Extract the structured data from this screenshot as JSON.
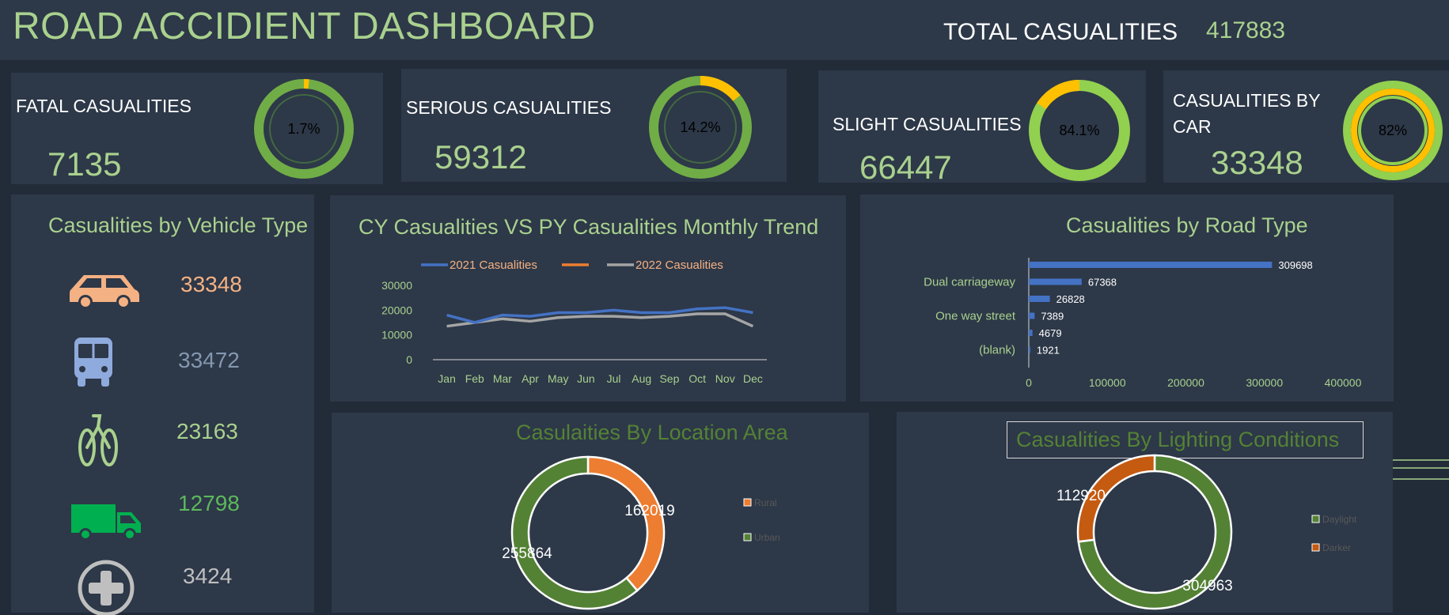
{
  "header": {
    "title": "ROAD ACCIDIENT DASHBOARD",
    "total_label": "TOTAL CASUALITIES",
    "total_value": "417883"
  },
  "kpis": [
    {
      "label": "FATAL CASUALITIES",
      "value": "7135",
      "pct_label": "1.7%",
      "pct": 1.7
    },
    {
      "label": "SERIOUS CASUALITIES",
      "value": "59312",
      "pct_label": "14.2%",
      "pct": 14.2
    },
    {
      "label": "SLIGHT CASUALITIES",
      "value": "66447",
      "pct_label": "84.1%",
      "pct": 84.1
    },
    {
      "label_line1": "CASUALITIES BY",
      "label_line2": "CAR",
      "value": "33348",
      "pct_label": "82%",
      "pct": 82
    }
  ],
  "vehicle": {
    "title": "Casualities by Vehicle Type",
    "items": [
      {
        "icon": "car-icon",
        "value": "33348",
        "color": "#f4b183"
      },
      {
        "icon": "bus-icon",
        "value": "33472",
        "color": "#8497b0"
      },
      {
        "icon": "bicycle-icon",
        "value": "23163",
        "color": "#a9d18e"
      },
      {
        "icon": "truck-icon",
        "value": "12798",
        "color": "#5cb85c"
      },
      {
        "icon": "plus-circle-icon",
        "value": "3424",
        "color": "#bfbfbf"
      }
    ]
  },
  "colors": {
    "green": "#70ad47",
    "dark_green": "#548235",
    "light_green": "#92d050",
    "gold": "#ffc000",
    "orange": "#ed7d31",
    "blue": "#4472c4",
    "gray": "#a5a5a5",
    "dark_orange": "#c55a11"
  },
  "chart_data": [
    {
      "type": "line",
      "title": "CY Casualities VS PY Casualities Monthly Trend",
      "categories": [
        "Jan",
        "Feb",
        "Mar",
        "Apr",
        "May",
        "Jun",
        "Jul",
        "Aug",
        "Sep",
        "Oct",
        "Nov",
        "Dec"
      ],
      "legend": [
        "2021 Casualities",
        "",
        "2022 Casualities"
      ],
      "series": [
        {
          "name": "2021 Casualities",
          "color": "#4472c4",
          "values": [
            18000,
            15000,
            18000,
            17500,
            19000,
            19000,
            20000,
            19000,
            19000,
            20500,
            21000,
            19000
          ]
        },
        {
          "name": "2022 Casualities",
          "color": "#a5a5a5",
          "values": [
            13500,
            15000,
            16500,
            15500,
            17000,
            17500,
            17500,
            17000,
            17500,
            18500,
            18500,
            13500
          ]
        }
      ],
      "yticks": [
        0,
        10000,
        20000,
        30000
      ],
      "ylim": [
        0,
        30000
      ]
    },
    {
      "type": "bar",
      "orientation": "horizontal",
      "title": "Casualities by Road Type",
      "categories": [
        "",
        "Dual carriageway",
        "",
        "One way street",
        "",
        "(blank)"
      ],
      "values": [
        309698,
        67368,
        26828,
        7389,
        4679,
        1921
      ],
      "value_labels": [
        "309698",
        "67368",
        "26828",
        "7389",
        "4679",
        "1921"
      ],
      "xticks": [
        "0",
        "100000",
        "200000",
        "300000",
        "400000"
      ],
      "xlim": [
        0,
        400000
      ],
      "color": "#4472c4"
    },
    {
      "type": "pie",
      "donut": true,
      "title": "Casulaities By Location Area",
      "labels": [
        "Rural",
        "Urban"
      ],
      "values": [
        162019,
        255864
      ],
      "value_labels": [
        "162019",
        "255864"
      ],
      "colors": [
        "#ed7d31",
        "#548235"
      ]
    },
    {
      "type": "pie",
      "donut": true,
      "title": "Casualities By Lighting Conditions",
      "labels": [
        "Daylight",
        "Darker"
      ],
      "values": [
        304963,
        112920
      ],
      "value_labels": [
        "304963",
        "112920"
      ],
      "colors": [
        "#548235",
        "#c55a11"
      ]
    }
  ]
}
